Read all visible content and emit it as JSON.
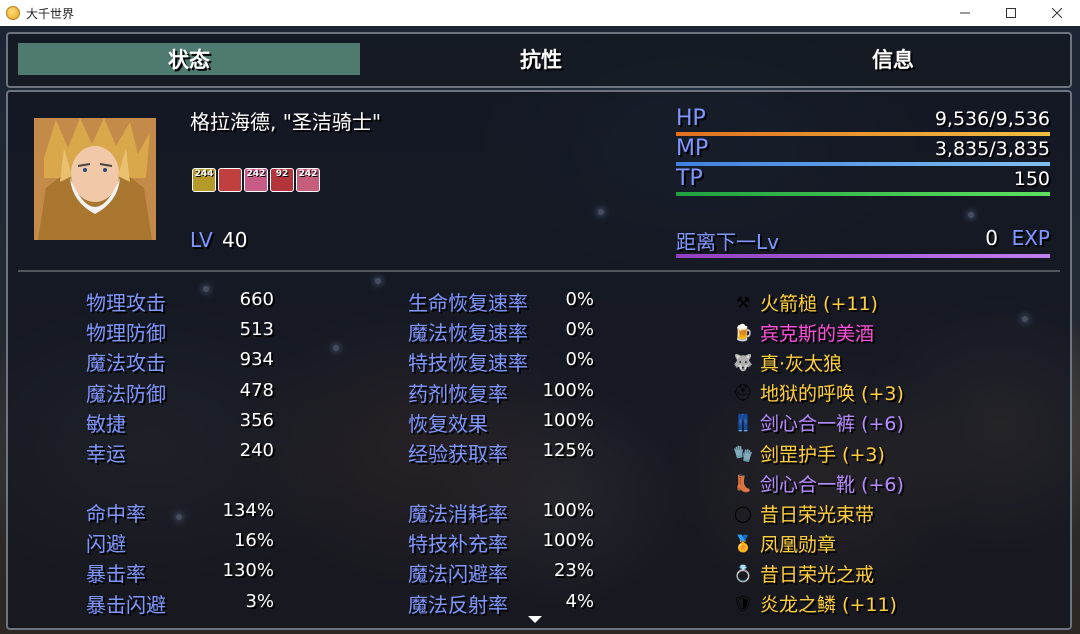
{
  "window": {
    "title": "大千世界"
  },
  "tabs": [
    {
      "label": "状态",
      "active": true
    },
    {
      "label": "抗性",
      "active": false
    },
    {
      "label": "信息",
      "active": false
    }
  ],
  "actor": {
    "name": "格拉海德, \"圣洁骑士\"",
    "level_label": "LV",
    "level": "40",
    "states": [
      {
        "icon": "holy-buff-icon",
        "turns": "244",
        "color": "#b59a2a"
      },
      {
        "icon": "crimson-buff-icon",
        "turns": "",
        "color": "#c04040"
      },
      {
        "icon": "pink-buff-icon",
        "turns": "242",
        "color": "#c85a86"
      },
      {
        "icon": "red-buff-icon",
        "turns": "92",
        "color": "#b3343a"
      },
      {
        "icon": "rose-buff-icon",
        "turns": "242",
        "color": "#c45e7a"
      }
    ]
  },
  "gauges": [
    {
      "label": "HP",
      "value": "9,536/9,536",
      "fill": 1.0,
      "color_from": "#e07020",
      "color_to": "#f0c040"
    },
    {
      "label": "MP",
      "value": "3,835/3,835",
      "fill": 1.0,
      "color_from": "#4080e0",
      "color_to": "#80c0f0"
    },
    {
      "label": "TP",
      "value": "150",
      "fill": 1.0,
      "color_from": "#20a040",
      "color_to": "#60e060"
    }
  ],
  "exp": {
    "label": "距离下一Lv",
    "value": "0",
    "unit": "EXP",
    "color_from": "#9040c0",
    "color_to": "#c080f0"
  },
  "params_a": [
    {
      "label": "物理攻击",
      "value": "660"
    },
    {
      "label": "物理防御",
      "value": "513"
    },
    {
      "label": "魔法攻击",
      "value": "934"
    },
    {
      "label": "魔法防御",
      "value": "478"
    },
    {
      "label": "敏捷",
      "value": "356"
    },
    {
      "label": "幸运",
      "value": "240"
    }
  ],
  "params_b": [
    {
      "label": "命中率",
      "value": "134%"
    },
    {
      "label": "闪避",
      "value": "16%"
    },
    {
      "label": "暴击率",
      "value": "130%"
    },
    {
      "label": "暴击闪避",
      "value": "3%"
    }
  ],
  "params_c": [
    {
      "label": "生命恢复速率",
      "value": "0%"
    },
    {
      "label": "魔法恢复速率",
      "value": "0%"
    },
    {
      "label": "特技恢复速率",
      "value": "0%"
    },
    {
      "label": "药剂恢复率",
      "value": "100%"
    },
    {
      "label": "恢复效果",
      "value": "100%"
    },
    {
      "label": "经验获取率",
      "value": "125%"
    }
  ],
  "params_d": [
    {
      "label": "魔法消耗率",
      "value": "100%"
    },
    {
      "label": "特技补充率",
      "value": "100%"
    },
    {
      "label": "魔法闪避率",
      "value": "23%"
    },
    {
      "label": "魔法反射率",
      "value": "4%"
    }
  ],
  "equipment": [
    {
      "name": "火箭槌 (+11)",
      "icon": "hammer-icon",
      "color": "#ffce3d"
    },
    {
      "name": "宾克斯的美酒",
      "icon": "mug-icon",
      "color": "#ff4fd8"
    },
    {
      "name": "真·灰太狼",
      "icon": "wolf-icon",
      "color": "#ffce3d"
    },
    {
      "name": "地狱的呼唤 (+3)",
      "icon": "helmet-icon",
      "color": "#ffce3d"
    },
    {
      "name": "剑心合一裤 (+6)",
      "icon": "pants-icon",
      "color": "#b58cff"
    },
    {
      "name": "剑罡护手 (+3)",
      "icon": "gauntlet-icon",
      "color": "#ffce3d"
    },
    {
      "name": "剑心合一靴 (+6)",
      "icon": "boots-icon",
      "color": "#b58cff"
    },
    {
      "name": "昔日荣光束带",
      "icon": "belt-icon",
      "color": "#ffce3d"
    },
    {
      "name": "凤凰勋章",
      "icon": "medal-icon",
      "color": "#ffce3d"
    },
    {
      "name": "昔日荣光之戒",
      "icon": "ring-icon",
      "color": "#ffce3d"
    },
    {
      "name": "炎龙之鳞 (+11)",
      "icon": "dragon-scale-icon",
      "color": "#ffce3d"
    }
  ]
}
